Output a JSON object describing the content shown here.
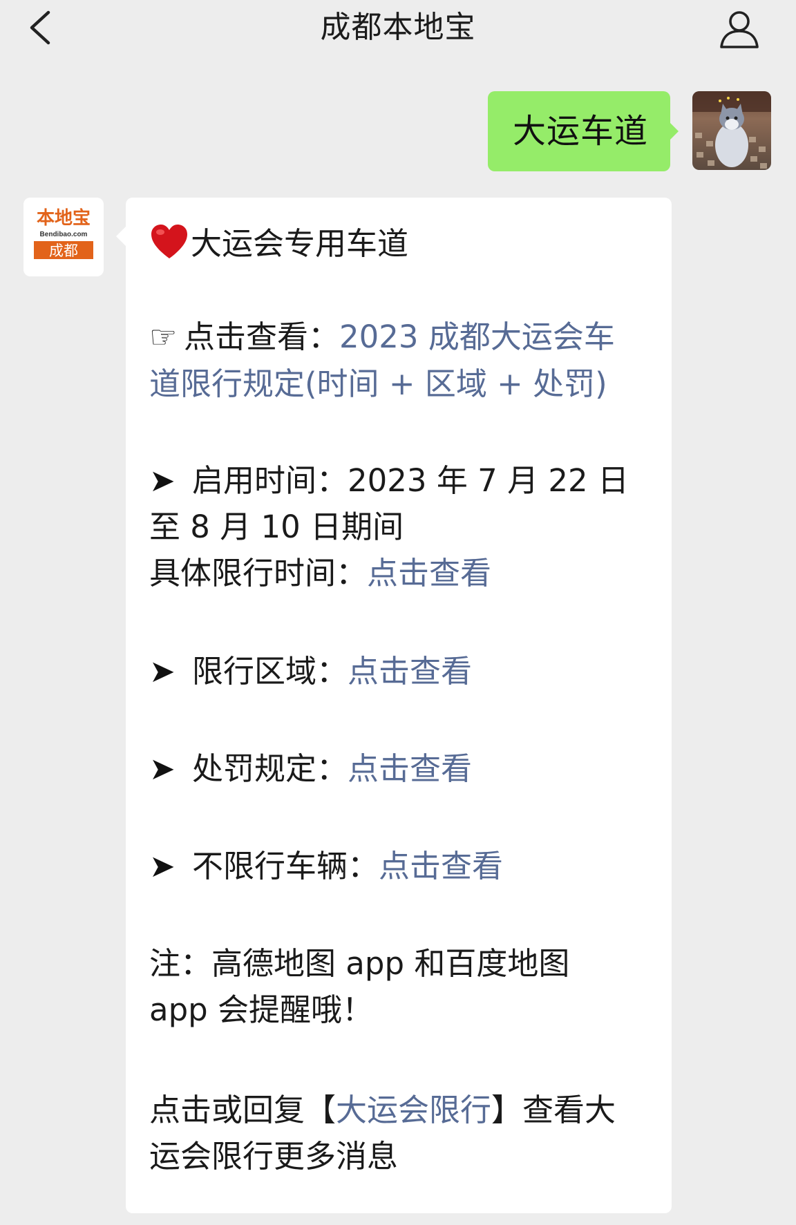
{
  "header": {
    "title": "成都本地宝",
    "back_icon": "chevron-left-icon",
    "profile_icon": "person-outline-icon"
  },
  "outgoing": {
    "text": "大运车道",
    "bubble_color": "#95ec69",
    "avatar": "user-avatar-cat"
  },
  "bot": {
    "avatar": {
      "logo_text": "本地宝",
      "domain": "Bendibao.com",
      "city": "成都",
      "brand_color": "#e2631a"
    },
    "link_color": "#576b95",
    "heading": "大运会专用车道",
    "click_view": {
      "icon": "☞",
      "prefix": "点击查看：",
      "link_line1": "2023 成都大运会车",
      "link_line2": "道限行规定(时间 + 区域 + 处罚)"
    },
    "start_time": {
      "icon": "➤",
      "label": "启用时间：",
      "line1_value": "2023 年 7 月 22 日",
      "line2": "至 8 月 10 日期间"
    },
    "specific_time": {
      "label": "具体限行时间：",
      "link": "点击查看"
    },
    "zone": {
      "icon": "➤",
      "label": "限行区域：",
      "link": "点击查看"
    },
    "penalty": {
      "icon": "➤",
      "label": "处罚规定：",
      "link": "点击查看"
    },
    "exempt": {
      "icon": "➤",
      "label": "不限行车辆：",
      "link": "点击查看"
    },
    "note": {
      "line1": "注：高德地图 app 和百度地图",
      "line2": "app 会提醒哦！"
    },
    "reply": {
      "prefix": "点击或回复【",
      "link": "大运会限行",
      "suffix": "】查看大",
      "line2": "运会限行更多消息"
    }
  }
}
